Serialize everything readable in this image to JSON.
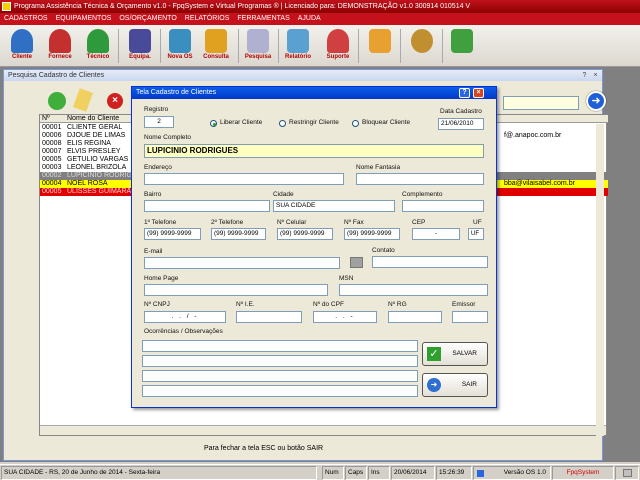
{
  "window": {
    "title": "Programa Assistência Técnica & Orçamento v1.0 - FpqSystem e Virtual Programas ® | Licenciado para: DEMONSTRAÇÃO v1.0 300914 010514 V"
  },
  "menu": [
    "CADASTROS",
    "EQUIPAMENTOS",
    "OS/ORÇAMENTO",
    "RELATÓRIOS",
    "FERRAMENTAS",
    "AJUDA"
  ],
  "toolbar": [
    {
      "label": "Cliente",
      "icon": "client-icon",
      "color": "#2f6fc4"
    },
    {
      "label": "Fornece",
      "icon": "supplier-icon",
      "color": "#c4302f"
    },
    {
      "label": "Técnico",
      "icon": "technician-icon",
      "color": "#2f9a3c"
    },
    {
      "label": "Equipa.",
      "icon": "equipment-icon",
      "color": "#4a4a9a"
    },
    {
      "label": "Nova OS",
      "icon": "new-os-icon",
      "color": "#3a8fc0"
    },
    {
      "label": "Consulta",
      "icon": "folder-icon",
      "color": "#e0a020"
    },
    {
      "label": "Pesquisa",
      "icon": "search-doc-icon",
      "color": "#b0b0d0"
    },
    {
      "label": "Relatório",
      "icon": "report-icon",
      "color": "#5aa0d0"
    },
    {
      "label": "Suporte",
      "icon": "support-icon",
      "color": "#d04040"
    },
    {
      "label": "",
      "icon": "calculator-icon",
      "color": "#e8a030"
    },
    {
      "label": "",
      "icon": "settings-icon",
      "color": "#c09030"
    },
    {
      "label": "",
      "icon": "exit-icon",
      "color": "#40a040"
    }
  ],
  "search_window": {
    "title": "Pesquisa Cadastro de Clientes",
    "columns": [
      "Nº",
      "Nome do Cliente"
    ],
    "rows": [
      {
        "num": "00001",
        "name": "CLIENTE GERAL",
        "extra": ""
      },
      {
        "num": "00006",
        "name": "DJOUE DE LIMAS",
        "extra": "f@.anapoc.com.br"
      },
      {
        "num": "00008",
        "name": "ELIS REGINA",
        "extra": ""
      },
      {
        "num": "00007",
        "name": "ELVIS PRESLEY",
        "extra": ""
      },
      {
        "num": "00005",
        "name": "GETULIO VARGAS",
        "extra": ""
      },
      {
        "num": "00003",
        "name": "LEONEL BRIZOLA",
        "extra": ""
      },
      {
        "num": "00002",
        "name": "LUPICINIO RODRIGUES",
        "extra": ""
      },
      {
        "num": "00004",
        "name": "NOEL ROSA",
        "extra": "bba@vilaisabel.com.br"
      },
      {
        "num": "00005",
        "name": "ULISSES GUIMARÃES",
        "extra": ""
      }
    ],
    "status_hint": "Para fechar a tela ESC ou botão SAIR"
  },
  "dialog": {
    "title": "Tela Cadastro de Clientes",
    "registro_label": "Registro",
    "registro_value": "2",
    "radio_liberar": "Liberar Cliente",
    "radio_restringir": "Restringir Cliente",
    "radio_bloquear": "Bloquear Cliente",
    "data_label": "Data Cadastro",
    "data_value": "21/06/2010",
    "nome_label": "Nome Completo",
    "nome_value": "LUPICINIO RODRIGUES",
    "endereco_label": "Endereço",
    "fantasia_label": "Nome Fantasia",
    "bairro_label": "Bairro",
    "cidade_label": "Cidade",
    "cidade_value": "SUA CIDADE",
    "complemento_label": "Complemento",
    "tel1_label": "1º Telefone",
    "tel1_value": "(99) 9999-9999",
    "tel2_label": "2º Telefone",
    "tel2_value": "(99) 9999-9999",
    "cel_label": "Nº Celular",
    "cel_value": "(99) 9999-9999",
    "fax_label": "Nº Fax",
    "fax_value": "(99) 9999-9999",
    "cep_label": "CEP",
    "cep_value": "-",
    "uf_label": "UF",
    "uf_value": "UF",
    "email_label": "E-mail",
    "contato_label": "Contato",
    "homepage_label": "Home Page",
    "msn_label": "MSN",
    "cnpj_label": "Nº CNPJ",
    "cnpj_value": ". . / -",
    "ie_label": "Nº I.E.",
    "cpf_label": "Nº do CPF",
    "cpf_value": ". . -",
    "rg_label": "Nº RG",
    "emissor_label": "Emissor",
    "obs_label": "Ocorrências / Observações",
    "salvar_label": "SALVAR",
    "sair_label": "SAIR"
  },
  "statusbar": {
    "cidade": "SUA CIDADE - RS, 20 de Junho de 2014 - Sexta-feira",
    "num": "Num",
    "caps": "Caps",
    "ins": "Ins",
    "date": "20/06/2014",
    "time": "15:26:39",
    "versao": "Versão OS 1.0",
    "brand": "FpqSystem"
  }
}
